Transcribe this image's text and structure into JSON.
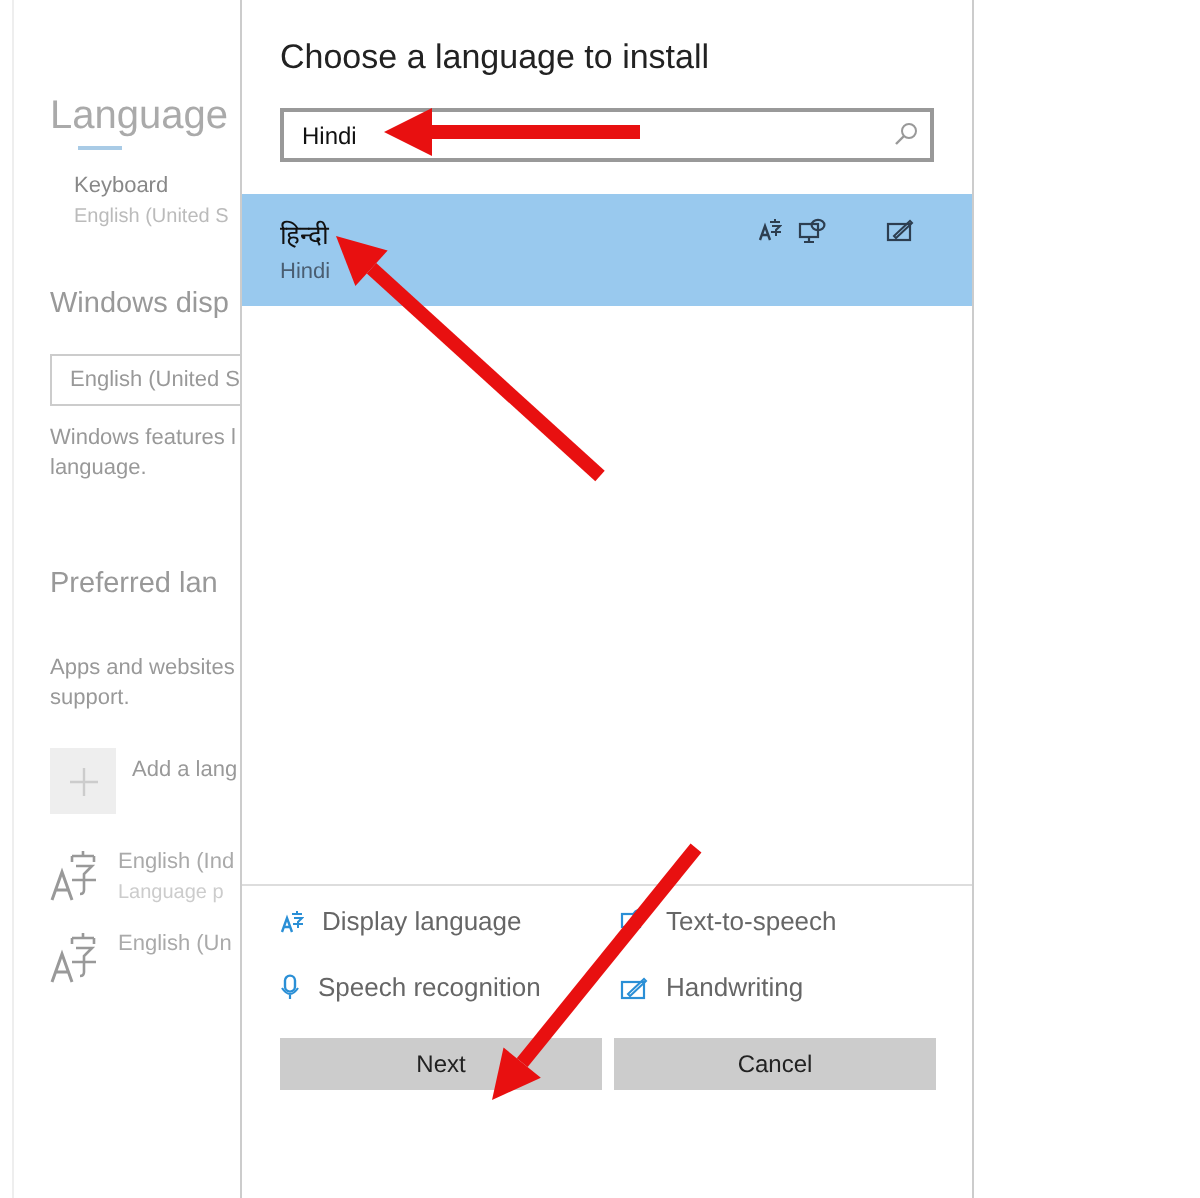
{
  "settings_page": {
    "title": "Language",
    "keyboard": {
      "label": "Keyboard",
      "value": "English (United S"
    },
    "display_section": {
      "heading": "Windows disp",
      "dropdown_value": "English (United S",
      "description": [
        "Windows features l",
        "language."
      ]
    },
    "preferred_section": {
      "heading": "Preferred lan",
      "description": [
        "Apps and websites",
        "support."
      ],
      "add_label": "Add a lang",
      "languages": [
        {
          "name": "English (Ind",
          "detail": "Language p"
        },
        {
          "name": "English (Un"
        }
      ]
    }
  },
  "dialog": {
    "title": "Choose a language to install",
    "search": {
      "value": "Hindi"
    },
    "results": [
      {
        "native_name": "हिन्दी",
        "name": "Hindi",
        "selected": true,
        "features": [
          {
            "kind": "display_language"
          },
          {
            "kind": "text_to_speech"
          },
          {
            "kind": "handwriting"
          }
        ]
      }
    ],
    "legend": [
      {
        "kind": "display_language",
        "label": "Display language"
      },
      {
        "kind": "text_to_speech",
        "label": "Text-to-speech"
      },
      {
        "kind": "speech_recognition",
        "label": "Speech recognition"
      },
      {
        "kind": "handwriting",
        "label": "Handwriting"
      }
    ],
    "buttons": [
      {
        "label": "Next"
      },
      {
        "label": "Cancel"
      }
    ]
  }
}
